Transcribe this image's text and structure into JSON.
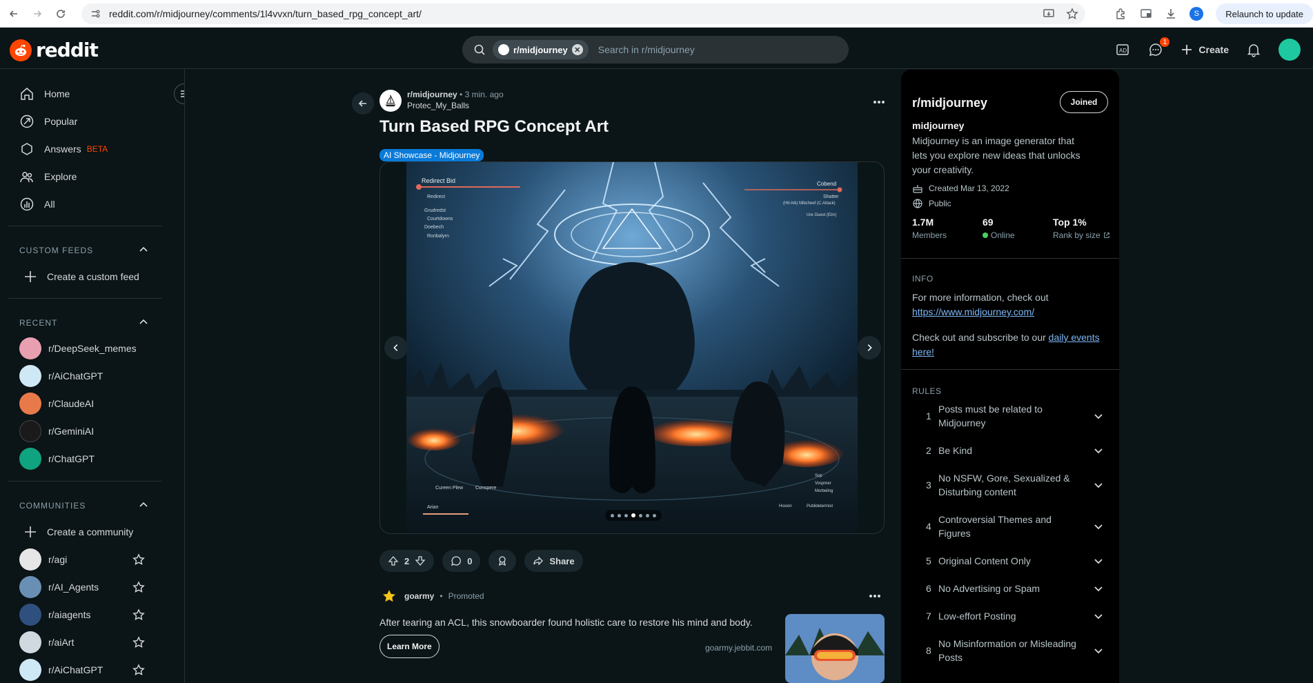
{
  "browser": {
    "url": "reddit.com/r/midjourney/comments/1l4vvxn/turn_based_rpg_concept_art/",
    "profile_initial": "S",
    "relaunch_label": "Relaunch to update"
  },
  "header": {
    "logo_text": "reddit",
    "search_chip": "r/midjourney",
    "search_placeholder": "Search in r/midjourney",
    "chat_badge": "1",
    "create_label": "Create"
  },
  "sidebar": {
    "nav": [
      {
        "label": "Home",
        "icon": "home-icon"
      },
      {
        "label": "Popular",
        "icon": "popular-icon"
      },
      {
        "label": "Answers",
        "icon": "answers-icon",
        "badge": "BETA"
      },
      {
        "label": "Explore",
        "icon": "explore-icon"
      },
      {
        "label": "All",
        "icon": "all-icon"
      }
    ],
    "custom_feeds_title": "CUSTOM FEEDS",
    "create_feed_label": "Create a custom feed",
    "recent_title": "RECENT",
    "recent": [
      {
        "label": "r/DeepSeek_memes",
        "color": "#e8a0b0"
      },
      {
        "label": "r/AiChatGPT",
        "color": "#cfe8f5"
      },
      {
        "label": "r/ClaudeAI",
        "color": "#e87a4a"
      },
      {
        "label": "r/GeminiAI",
        "color": "#1a1a1a"
      },
      {
        "label": "r/ChatGPT",
        "color": "#10a37f"
      }
    ],
    "communities_title": "COMMUNITIES",
    "create_community_label": "Create a community",
    "communities": [
      {
        "label": "r/agi",
        "color": "#e6e6e6"
      },
      {
        "label": "r/AI_Agents",
        "color": "#6a8fb5"
      },
      {
        "label": "r/aiagents",
        "color": "#2f4f7f"
      },
      {
        "label": "r/aiArt",
        "color": "#d0d8e0"
      },
      {
        "label": "r/AiChatGPT",
        "color": "#cfe8f5"
      }
    ]
  },
  "post": {
    "subreddit": "r/midjourney",
    "time": "3 min. ago",
    "author": "Protec_My_Balls",
    "title": "Turn Based RPG Concept Art",
    "flair": "AI Showcase - Midjourney",
    "votes": "2",
    "comments": "0",
    "share_label": "Share",
    "carousel_count": 7,
    "carousel_active": 3,
    "hud": {
      "top_left_title": "Redirect Bid",
      "menu": [
        "Redirect",
        "Grudredst",
        "Courtdowns",
        "Doebech",
        "Ronbalyrn"
      ],
      "top_right_title": "Cobend",
      "top_right_sub": "Shatter",
      "top_right_sub2": "(Hit Atk) Mibcheef (C.Attack)",
      "top_right_sub3": "Ure Guest (Elm)",
      "bottom_left": [
        "Cureen Plew",
        "Conspere"
      ],
      "bottom_left_name": "Arian",
      "bottom_right": [
        "Sop",
        "Vospmer",
        "Morbeling",
        "Publidetermist"
      ],
      "bottom_right_label": "Hosion"
    }
  },
  "promo": {
    "name": "goarmy",
    "tag": "Promoted",
    "text": "After tearing an ACL, this snowboarder found holistic care to restore his mind and body.",
    "button": "Learn More",
    "domain": "goarmy.jebbit.com"
  },
  "community": {
    "title": "r/midjourney",
    "joined_label": "Joined",
    "name": "midjourney",
    "description": "Midjourney is an image generator that lets you explore new ideas that unlocks your creativity.",
    "created": "Created Mar 13, 2022",
    "visibility": "Public",
    "members_value": "1.7M",
    "members_label": "Members",
    "online_value": "69",
    "online_label": "Online",
    "rank_value": "Top 1%",
    "rank_label": "Rank by size",
    "info_heading": "INFO",
    "info_text": "For more information, check out",
    "info_link": "https://www.midjourney.com/",
    "events_text": "Check out and subscribe to our",
    "events_link_1": "daily events",
    "events_link_2": "here!",
    "rules_heading": "RULES",
    "rules": [
      {
        "num": "1",
        "text": "Posts must be related to Midjourney"
      },
      {
        "num": "2",
        "text": "Be Kind"
      },
      {
        "num": "3",
        "text": "No NSFW, Gore, Sexualized & Disturbing content"
      },
      {
        "num": "4",
        "text": "Controversial Themes and Figures"
      },
      {
        "num": "5",
        "text": "Original Content Only"
      },
      {
        "num": "6",
        "text": "No Advertising or Spam"
      },
      {
        "num": "7",
        "text": "Low-effort Posting"
      },
      {
        "num": "8",
        "text": "No Misinformation or Misleading Posts"
      }
    ]
  }
}
